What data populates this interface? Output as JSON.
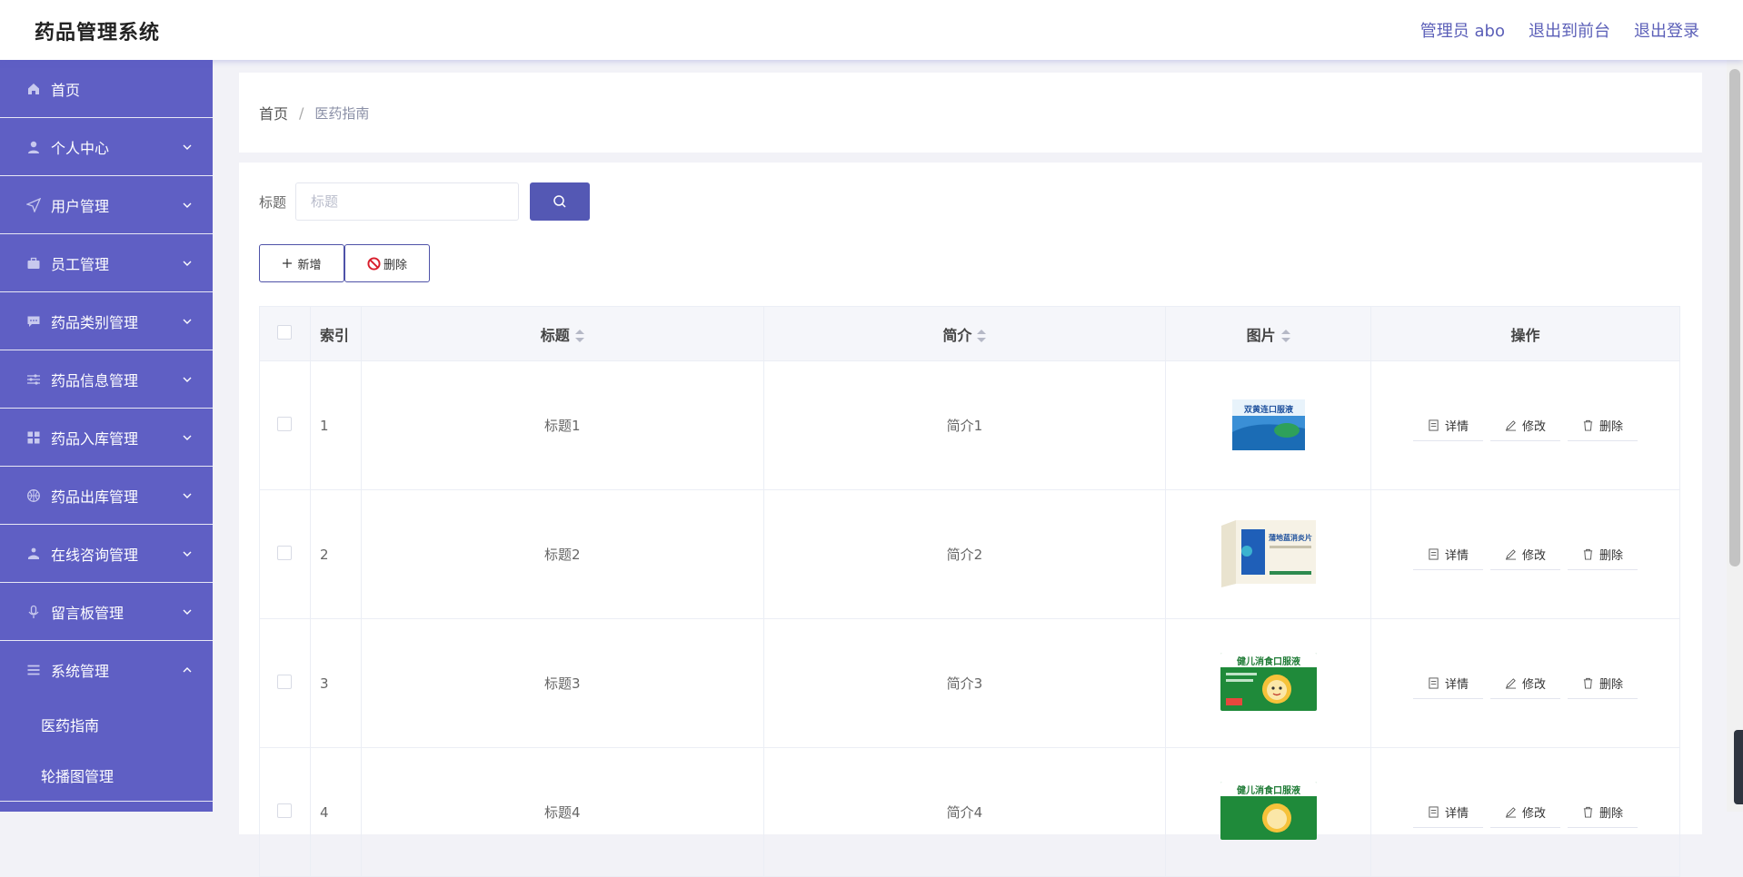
{
  "header": {
    "title": "药品管理系统",
    "admin": "管理员 abo",
    "to_front": "退出到前台",
    "logout": "退出登录"
  },
  "sidebar": {
    "items": [
      {
        "label": "首页",
        "icon": "home-icon"
      },
      {
        "label": "个人中心",
        "icon": "user-icon"
      },
      {
        "label": "用户管理",
        "icon": "send-icon"
      },
      {
        "label": "员工管理",
        "icon": "briefcase-icon"
      },
      {
        "label": "药品类别管理",
        "icon": "chat-icon"
      },
      {
        "label": "药品信息管理",
        "icon": "sliders-icon"
      },
      {
        "label": "药品入库管理",
        "icon": "grid-icon"
      },
      {
        "label": "药品出库管理",
        "icon": "basketball-icon"
      },
      {
        "label": "在线咨询管理",
        "icon": "person-stand-icon"
      },
      {
        "label": "留言板管理",
        "icon": "mic-icon"
      },
      {
        "label": "系统管理",
        "icon": "list-icon"
      }
    ],
    "sub_items": [
      "医药指南",
      "轮播图管理"
    ]
  },
  "breadcrumb": {
    "home": "首页",
    "separator": "/",
    "current": "医药指南"
  },
  "search": {
    "label": "标题",
    "placeholder": "标题"
  },
  "actions": {
    "add": "新增",
    "delete": "删除"
  },
  "table": {
    "headers": {
      "index": "索引",
      "title": "标题",
      "intro": "简介",
      "image": "图片",
      "ops": "操作"
    },
    "rows": [
      {
        "index": "1",
        "title": "标题1",
        "intro": "简介1",
        "image": "双黄连口服液"
      },
      {
        "index": "2",
        "title": "标题2",
        "intro": "简介2",
        "image": "蒲地蓝消炎片"
      },
      {
        "index": "3",
        "title": "标题3",
        "intro": "简介3",
        "image": "健儿消食口服液"
      },
      {
        "index": "4",
        "title": "标题4",
        "intro": "简介4",
        "image": "健儿消食口服液"
      }
    ],
    "op_labels": {
      "detail": "详情",
      "edit": "修改",
      "delete": "删除"
    }
  },
  "colors": {
    "sidebar_bg": "#5f5fc4",
    "accent": "#5458b4",
    "header_link": "#5b5fb8"
  }
}
